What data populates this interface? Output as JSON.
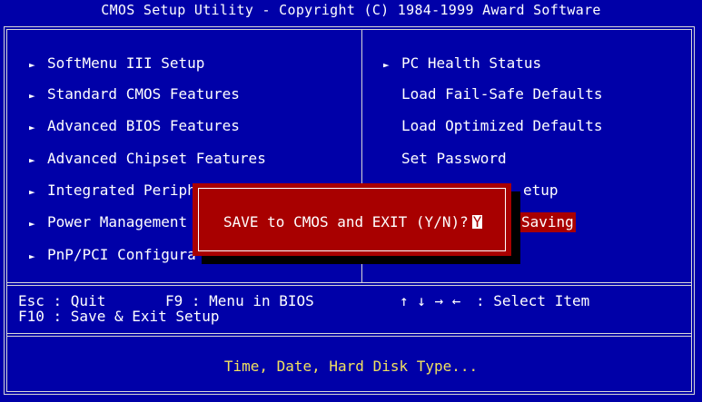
{
  "title": "CMOS Setup Utility - Copyright (C) 1984-1999 Award Software",
  "left_menu": [
    {
      "label": "SoftMenu III Setup",
      "arrow": true
    },
    {
      "label": "Standard CMOS Features",
      "arrow": true
    },
    {
      "label": "Advanced BIOS Features",
      "arrow": true
    },
    {
      "label": "Advanced Chipset Features",
      "arrow": true
    },
    {
      "label": "Integrated Periph",
      "arrow": true
    },
    {
      "label": "Power Management",
      "arrow": true
    },
    {
      "label": "PnP/PCI Configura",
      "arrow": true
    }
  ],
  "right_menu": [
    {
      "label": "PC Health Status",
      "arrow": true
    },
    {
      "label": "Load Fail-Safe Defaults",
      "arrow": false
    },
    {
      "label": "Load Optimized Defaults",
      "arrow": false
    },
    {
      "label": "Set Password",
      "arrow": false
    },
    {
      "label": "etup",
      "arrow": false
    },
    {
      "label": "Saving",
      "arrow": false
    }
  ],
  "dialog": {
    "prompt": "SAVE to CMOS and EXIT (Y/N)?",
    "input_value": "Y"
  },
  "help": {
    "esc": "Esc : Quit",
    "f9": "F9 : Menu in BIOS",
    "arrows": "↑ ↓ → ←",
    "select": ": Select Item",
    "f10": "F10 : Save & Exit Setup"
  },
  "status": "Time, Date, Hard Disk Type...",
  "colors": {
    "background": "#0000a8",
    "dialog": "#a80000",
    "frame": "#d8d8d8",
    "status_text": "#f0e060"
  }
}
